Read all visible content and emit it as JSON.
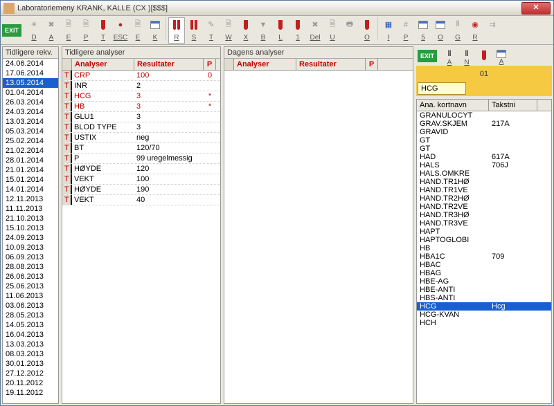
{
  "window": {
    "title": "Laboratoriemeny KRANK, KALLE (CX  )[$$$]"
  },
  "toolbar": {
    "exit": "EXIT",
    "buttons": [
      {
        "lbl": "D",
        "ico": "☀",
        "cls": "grey-ico"
      },
      {
        "lbl": "A",
        "ico": "✖",
        "cls": "grey-ico"
      },
      {
        "lbl": "E",
        "ico": "🗎",
        "cls": "grey-ico"
      },
      {
        "lbl": "P",
        "ico": "🗎",
        "cls": "grey-ico"
      },
      {
        "lbl": "T",
        "ico": "tube",
        "cls": ""
      },
      {
        "lbl": "ESC",
        "ico": "●",
        "cls": "red-ico"
      },
      {
        "lbl": "E",
        "ico": "🗎",
        "cls": "grey-ico"
      },
      {
        "lbl": "K",
        "ico": "cal",
        "cls": ""
      },
      {
        "lbl": "R",
        "ico": "tube2",
        "cls": "",
        "active": true
      },
      {
        "lbl": "S",
        "ico": "tube2",
        "cls": ""
      },
      {
        "lbl": "T",
        "ico": "✎",
        "cls": "grey-ico"
      },
      {
        "lbl": "W",
        "ico": "🗎",
        "cls": "grey-ico"
      },
      {
        "lbl": "X",
        "ico": "tube",
        "cls": ""
      },
      {
        "lbl": "B",
        "ico": "▼",
        "cls": "grey-ico"
      },
      {
        "lbl": "L",
        "ico": "tube",
        "cls": ""
      },
      {
        "lbl": "1",
        "ico": "tube",
        "cls": ""
      },
      {
        "lbl": "Del",
        "ico": "✖",
        "cls": "grey-ico"
      },
      {
        "lbl": "U",
        "ico": "🗎",
        "cls": "grey-ico"
      },
      {
        "lbl": "",
        "ico": "🖶",
        "cls": "grey-ico"
      },
      {
        "lbl": "O",
        "ico": "tube",
        "cls": ""
      },
      {
        "lbl": "I",
        "ico": "▦",
        "cls": "blue-ico"
      },
      {
        "lbl": "P",
        "ico": "#",
        "cls": "grey-ico"
      },
      {
        "lbl": "5",
        "ico": "cal",
        "cls": ""
      },
      {
        "lbl": "O",
        "ico": "cal",
        "cls": ""
      },
      {
        "lbl": "G",
        "ico": "⫴",
        "cls": "grey-ico"
      },
      {
        "lbl": "R",
        "ico": "◉",
        "cls": "red-ico"
      },
      {
        "lbl": "",
        "ico": "⇉",
        "cls": "grey-ico"
      }
    ]
  },
  "dates": {
    "header": "Tidligere rekv.",
    "items": [
      "24.06.2014",
      "17.06.2014",
      "13.05.2014",
      "01.04.2014",
      "26.03.2014",
      "24.03.2014",
      "13.03.2014",
      "05.03.2014",
      "25.02.2014",
      "21.02.2014",
      "28.01.2014",
      "21.01.2014",
      "15.01.2014",
      "14.01.2014",
      "12.11.2013",
      "11.11.2013",
      "21.10.2013",
      "15.10.2013",
      "24.09.2013",
      "10.09.2013",
      "06.09.2013",
      "28.08.2013",
      "26.06.2013",
      "25.06.2013",
      "11.06.2013",
      "03.06.2013",
      "28.05.2013",
      "14.05.2013",
      "16.04.2013",
      "13.03.2013",
      "08.03.2013",
      "30.01.2013",
      "27.12.2012",
      "20.11.2012",
      "19.11.2012"
    ],
    "selected": 2
  },
  "prev": {
    "header": "Tidligere analyser",
    "cols": {
      "ana": "Analyser",
      "res": "Resultater",
      "p": "P"
    },
    "rows": [
      {
        "t": "T",
        "ana": "CRP",
        "res": "100",
        "p": "0",
        "red": true
      },
      {
        "t": "T",
        "ana": "INR",
        "res": "2",
        "p": ""
      },
      {
        "t": "T",
        "ana": "HCG",
        "res": "3",
        "p": "*",
        "red": true
      },
      {
        "t": "T",
        "ana": "HB",
        "res": "3",
        "p": "*",
        "red": true
      },
      {
        "t": "T",
        "ana": "GLU1",
        "res": "3",
        "p": ""
      },
      {
        "t": "T",
        "ana": "BLOD TYPE",
        "res": "3",
        "p": ""
      },
      {
        "t": "T",
        "ana": "USTIX",
        "res": "neg",
        "p": ""
      },
      {
        "t": "T",
        "ana": "BT",
        "res": "120/70",
        "p": ""
      },
      {
        "t": "T",
        "ana": "P",
        "res": "99 uregelmessig",
        "p": ""
      },
      {
        "t": "T",
        "ana": "HØYDE",
        "res": "120",
        "p": ""
      },
      {
        "t": "T",
        "ana": "VEKT",
        "res": "100",
        "p": ""
      },
      {
        "t": "T",
        "ana": "HØYDE",
        "res": "190",
        "p": ""
      },
      {
        "t": "T",
        "ana": "VEKT",
        "res": "40",
        "p": ""
      }
    ]
  },
  "today": {
    "header": "Dagens analyser",
    "cols": {
      "ana": "Analyser",
      "res": "Resultater",
      "p": "P"
    }
  },
  "right": {
    "exit": "EXIT",
    "toolbar": [
      {
        "lbl": "A",
        "ico": "⫴"
      },
      {
        "lbl": "N",
        "ico": "⫴"
      },
      {
        "lbl": "",
        "ico": "tube"
      },
      {
        "lbl": "A",
        "ico": "cal"
      }
    ],
    "num": "01",
    "input": "HCG",
    "cols": {
      "an": "Ana. kortnavn",
      "tk": "Takstni"
    },
    "rows": [
      {
        "an": "GRANULOCYT",
        "tk": ""
      },
      {
        "an": "GRAV.SKJEM",
        "tk": "217A"
      },
      {
        "an": "GRAVID",
        "tk": ""
      },
      {
        "an": "GT",
        "tk": ""
      },
      {
        "an": "GT",
        "tk": ""
      },
      {
        "an": "HAD",
        "tk": "617A"
      },
      {
        "an": "HALS",
        "tk": "706J"
      },
      {
        "an": "HALS.OMKRE",
        "tk": ""
      },
      {
        "an": "HAND.TR1HØ",
        "tk": ""
      },
      {
        "an": "HAND.TR1VE",
        "tk": ""
      },
      {
        "an": "HAND.TR2HØ",
        "tk": ""
      },
      {
        "an": "HAND.TR2VE",
        "tk": ""
      },
      {
        "an": "HAND.TR3HØ",
        "tk": ""
      },
      {
        "an": "HAND.TR3VE",
        "tk": ""
      },
      {
        "an": "HAPT",
        "tk": ""
      },
      {
        "an": "HAPTOGLOBI",
        "tk": ""
      },
      {
        "an": "HB",
        "tk": ""
      },
      {
        "an": "HBA1C",
        "tk": "709"
      },
      {
        "an": "HBAC",
        "tk": ""
      },
      {
        "an": "HBAG",
        "tk": ""
      },
      {
        "an": "HBE-AG",
        "tk": ""
      },
      {
        "an": "HBE-ANTI",
        "tk": ""
      },
      {
        "an": "HBS-ANTI",
        "tk": ""
      },
      {
        "an": "HCG",
        "tk": "Hcg",
        "sel": true
      },
      {
        "an": "HCG-KVAN",
        "tk": ""
      },
      {
        "an": "HCH",
        "tk": ""
      }
    ]
  }
}
